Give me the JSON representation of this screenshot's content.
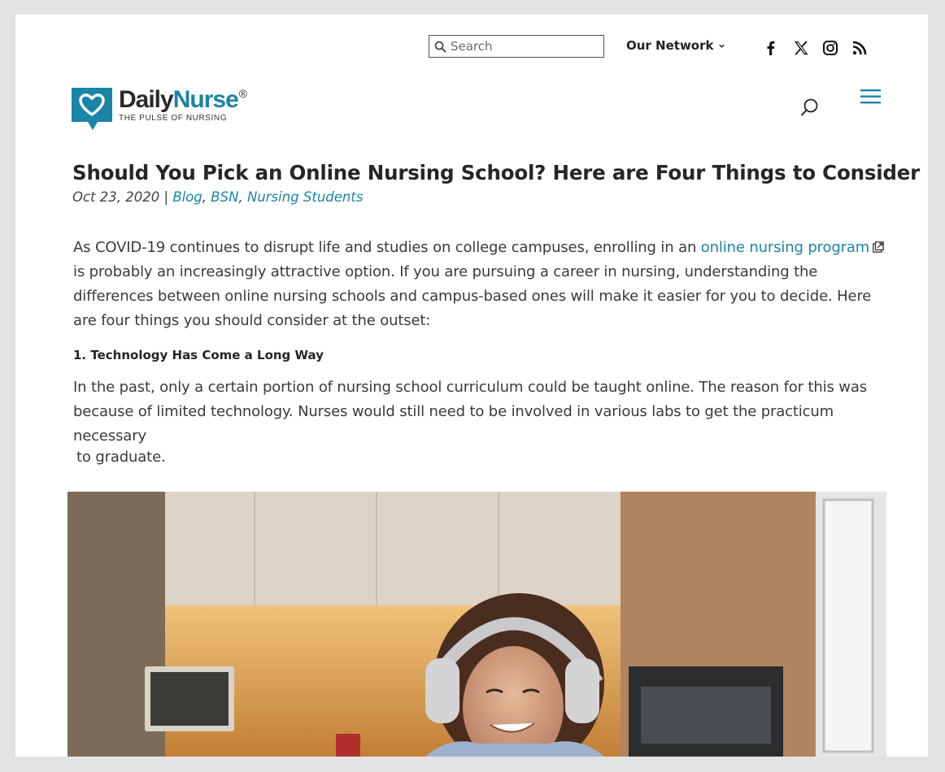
{
  "topbar": {
    "search_placeholder": "Search",
    "network_label": "Our Network"
  },
  "social": [
    {
      "name": "facebook-icon"
    },
    {
      "name": "x-icon"
    },
    {
      "name": "instagram-icon"
    },
    {
      "name": "rss-icon"
    }
  ],
  "logo": {
    "name_part1": "Daily",
    "name_part2": "Nurse",
    "registered": "®",
    "tagline": "The Pulse of Nursing"
  },
  "colors": {
    "accent": "#1a85a6",
    "title": "#262626",
    "page_bg": "#e3e3e3"
  },
  "article": {
    "title": "Should You Pick an Online Nursing School? Here are Four Things to Consider",
    "date": "Oct 23, 2020",
    "separator": "|",
    "categories": [
      "Blog",
      "BSN",
      "Nursing Students"
    ],
    "p1_before": "As COVID-19 continues to disrupt life and studies on college campuses, enrolling in an ",
    "p1_link": "online nursing program",
    "p1_after": " is probably an increasingly attractive option. If you are pursuing a career in nursing, understanding the differences between online nursing schools and campus-based ones will make it easier for you to decide. Here are four things you should consider at the outset:",
    "heading1": "1. Technology Has Come a Long Way",
    "p2_main": "In the past, only a certain portion of nursing school curriculum could be taught online. The reason for this was because of limited technology. Nurses would still need to be involved in various labs to get the practicum necessary",
    "p2_tail": "to graduate."
  }
}
